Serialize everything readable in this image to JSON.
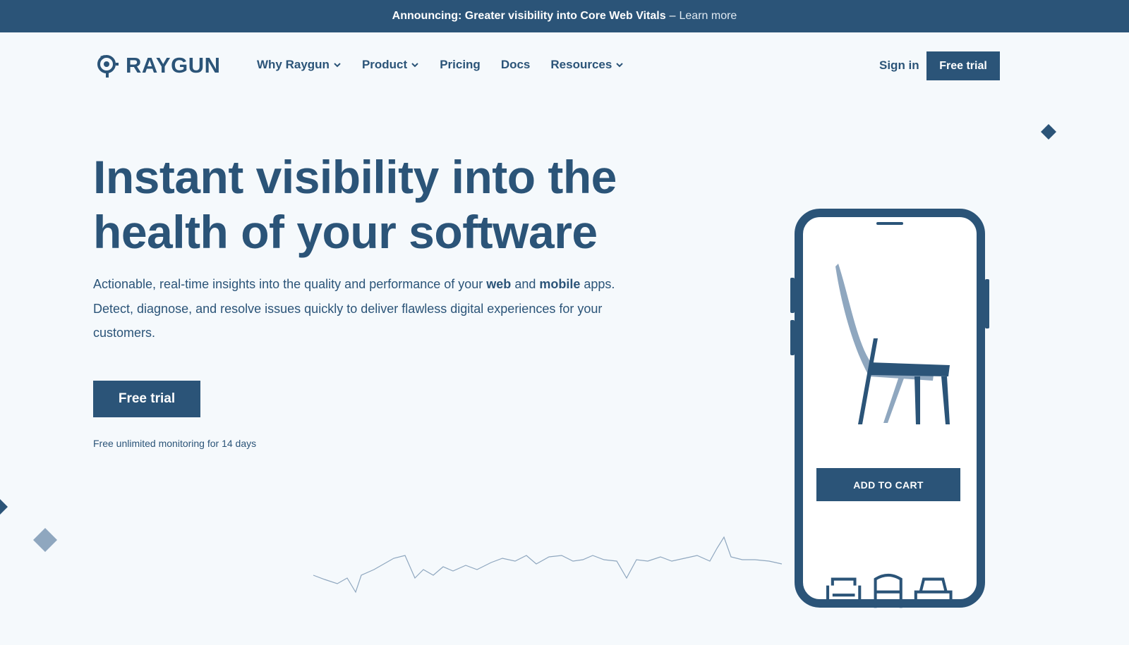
{
  "announcement": {
    "text": "Announcing: Greater visibility into Core Web Vitals",
    "separator": "–",
    "link": "Learn more"
  },
  "nav": {
    "logo": "RAYGUN",
    "items": [
      {
        "label": "Why Raygun",
        "dropdown": true
      },
      {
        "label": "Product",
        "dropdown": true
      },
      {
        "label": "Pricing",
        "dropdown": false
      },
      {
        "label": "Docs",
        "dropdown": false
      },
      {
        "label": "Resources",
        "dropdown": true
      }
    ],
    "signin": "Sign in",
    "cta": "Free trial"
  },
  "hero": {
    "title_line1": "Instant visibility into the",
    "title_line2": "health of your software",
    "subtitle_part1": "Actionable, real-time insights into the quality and performance of your ",
    "subtitle_bold1": "web",
    "subtitle_part2": " and ",
    "subtitle_bold2": "mobile",
    "subtitle_part3": " apps. Detect, diagnose, and resolve issues quickly to deliver flawless digital experiences for your customers.",
    "cta": "Free trial",
    "note": "Free unlimited monitoring for 14 days"
  },
  "phone": {
    "button": "ADD TO CART",
    "tab_icons": [
      "armchair-icon",
      "chair-icon",
      "bed-icon"
    ]
  },
  "colors": {
    "brand": "#2b5478",
    "background": "#f5f9fc",
    "accent_light": "#8fa7bf"
  }
}
